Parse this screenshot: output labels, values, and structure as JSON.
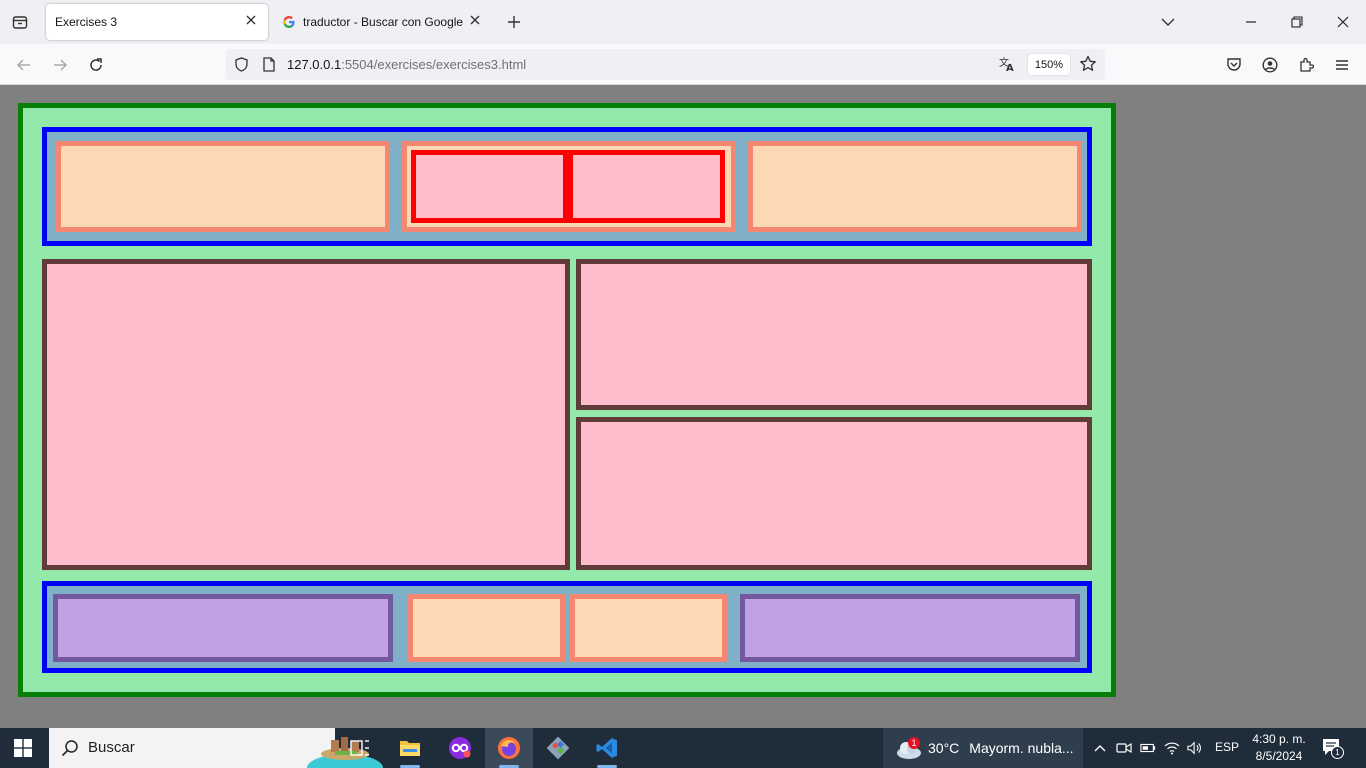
{
  "browser": {
    "tabs": [
      {
        "title": "Exercises 3",
        "active": true
      },
      {
        "title": "traductor - Buscar con Google",
        "active": false
      }
    ],
    "url_host": "127.0.0.1",
    "url_rest": ":5504/exercises/exercises3.html",
    "zoom": "150%"
  },
  "page": {
    "colors": {
      "background": "#808080",
      "outer_fill": "#93e9aa",
      "outer_border": "#067f06",
      "blue_border": "#0000ff",
      "peach_fill": "#fdd8b5",
      "peach_border": "#f48771",
      "red_border": "#ff0000",
      "pink_fill": "#ffbccb",
      "maroon_border": "#613a3a",
      "purple_fill": "#c1a0e4",
      "purple_border": "#72589c"
    }
  },
  "taskbar": {
    "search_placeholder": "Buscar",
    "weather_temp": "30°C",
    "weather_desc": "Mayorm. nubla...",
    "weather_badge": "1",
    "language": "ESP",
    "time": "4:30 p. m.",
    "date": "8/5/2024",
    "notification_count": "1"
  }
}
